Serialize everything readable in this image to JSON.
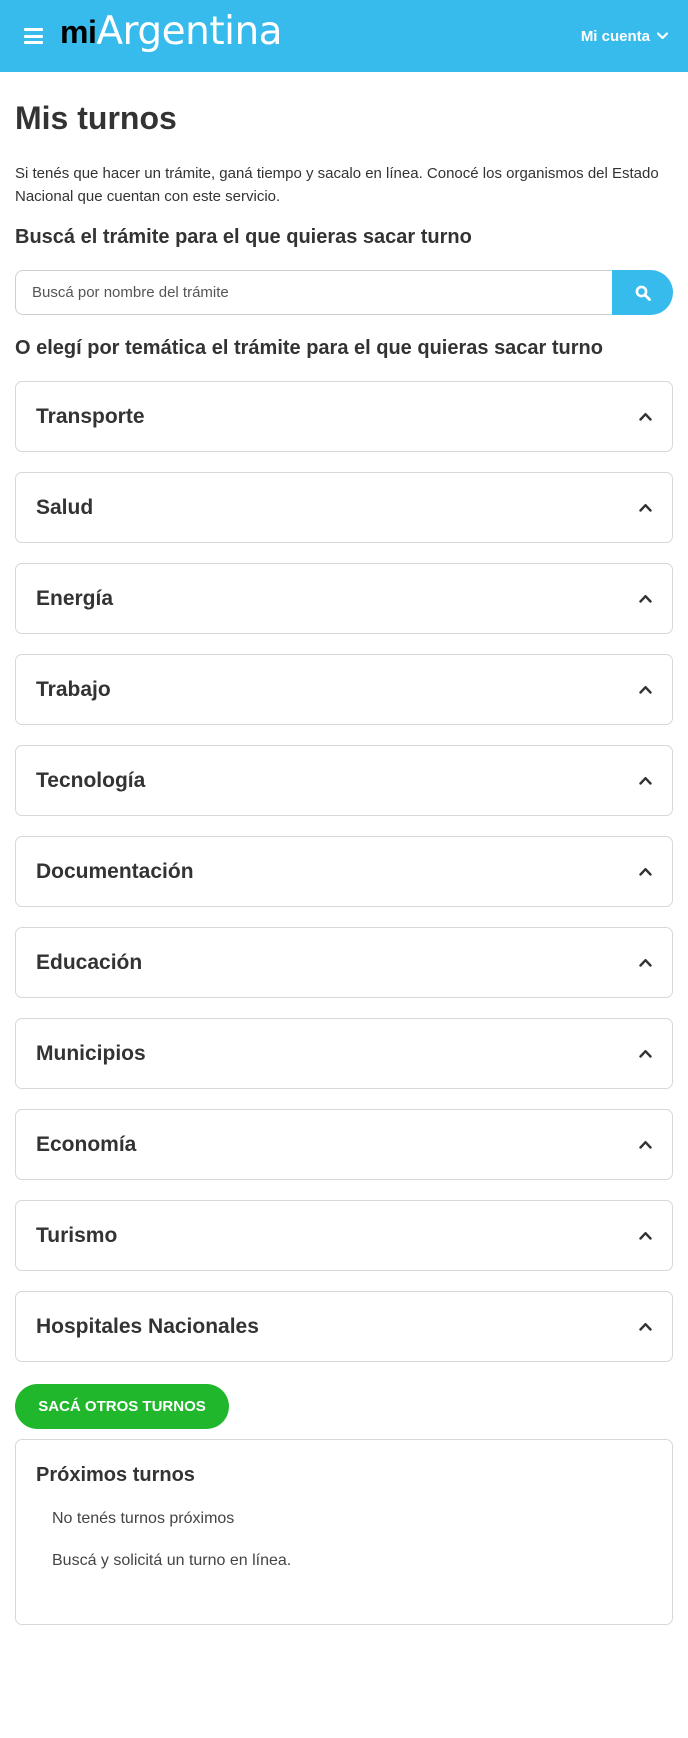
{
  "header": {
    "logo_mi": "mi",
    "logo_argentina": "Argentina",
    "account_label": "Mi cuenta",
    "menu_icon": "hamburger-icon",
    "account_icon": "chevron-down-icon",
    "bg_color": "#37bbed"
  },
  "page": {
    "title": "Mis turnos",
    "intro": "Si tenés que hacer un trámite, ganá tiempo y sacalo en línea. Conocé los organismos del Estado Nacional que cuentan con este servicio.",
    "search_heading": "Buscá el trámite para el que quieras sacar turno",
    "search_placeholder": "Buscá por nombre del trámite",
    "search_icon": "search-icon",
    "themes_heading": "O elegí por temática el trámite para el que quieras sacar turno"
  },
  "themes": [
    {
      "label": "Transporte"
    },
    {
      "label": "Salud"
    },
    {
      "label": "Energía"
    },
    {
      "label": "Trabajo"
    },
    {
      "label": "Tecnología"
    },
    {
      "label": "Documentación"
    },
    {
      "label": "Educación"
    },
    {
      "label": "Municipios"
    },
    {
      "label": "Economía"
    },
    {
      "label": "Turismo"
    },
    {
      "label": "Hospitales Nacionales"
    }
  ],
  "other_turns_button": "SACÁ OTROS TURNOS",
  "upcoming": {
    "title": "Próximos turnos",
    "empty_message": "No tenés turnos próximos",
    "hint": "Buscá y solicitá un turno en línea."
  },
  "colors": {
    "accent": "#37bbed",
    "success": "#20b72c",
    "text": "#333333",
    "border": "#d8d8d8"
  }
}
